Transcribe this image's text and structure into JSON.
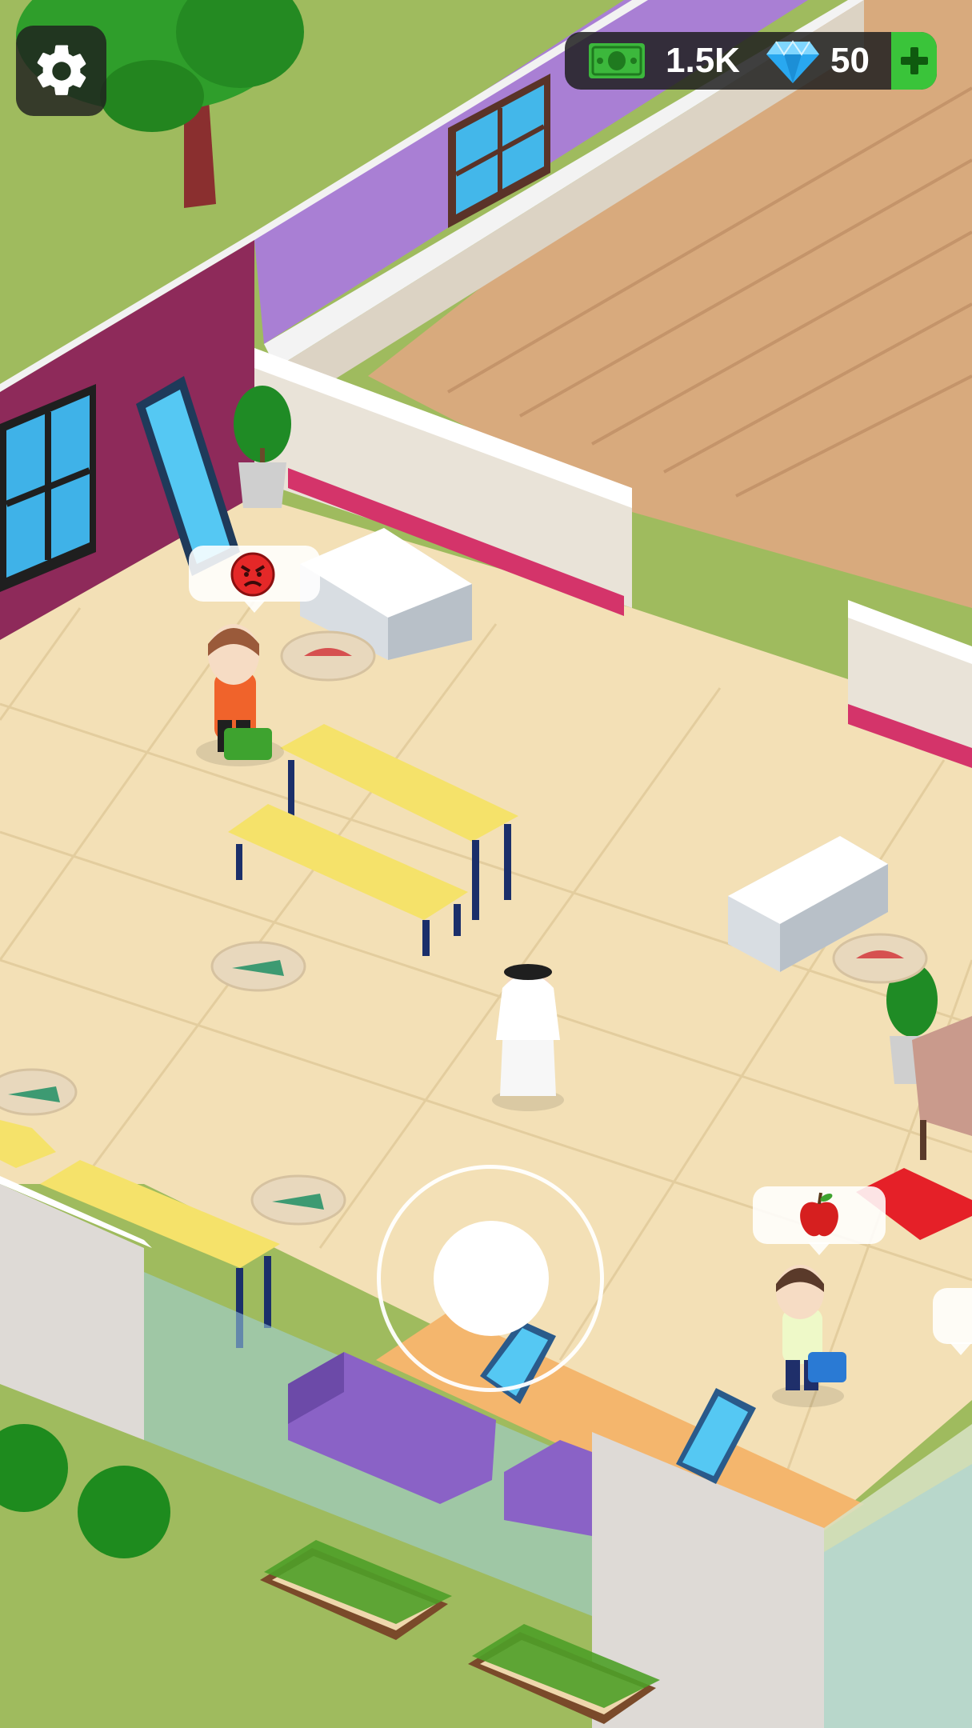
{
  "hud": {
    "cash": "1.5K",
    "gems": "50"
  },
  "icons": {
    "settings": "gear-icon",
    "cash": "cash-icon",
    "gem": "diamond-icon",
    "add": "plus-icon",
    "angry_mood": "angry-face-icon",
    "request_item": "apple-icon"
  },
  "colors": {
    "cash_green": "#3cb83c",
    "gem_blue": "#29a8f0",
    "plus_green": "#3ac43a",
    "angry_red": "#e52828",
    "apple_red": "#d61f1f"
  }
}
